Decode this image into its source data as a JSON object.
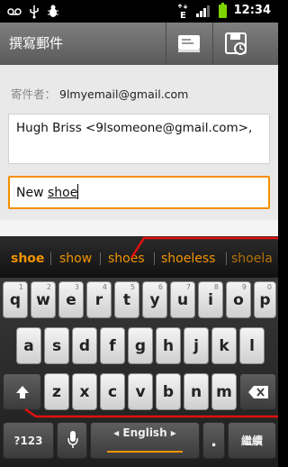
{
  "status_bar": {
    "time": "12:34",
    "icons": [
      "voicemail-icon",
      "usb-icon",
      "debug-icon",
      "edge-data-icon",
      "signal-icon",
      "battery-icon"
    ]
  },
  "title_bar": {
    "title": "撰寫郵件",
    "actions": [
      "send-icon",
      "save-draft-icon"
    ]
  },
  "compose": {
    "from_label": "寄件者：",
    "from_value": "9lmyemail@gmail.com",
    "to_value": "Hugh Briss <9lsomeone@gmail.com>,",
    "subject_prefix": "New ",
    "subject_word": "shoe"
  },
  "suggestions": [
    "shoe",
    "show",
    "shoes",
    "shoeless",
    "shoela"
  ],
  "keyboard": {
    "row1": [
      {
        "label": "q",
        "hint": "1"
      },
      {
        "label": "w",
        "hint": "2"
      },
      {
        "label": "e",
        "hint": "3"
      },
      {
        "label": "r",
        "hint": "4"
      },
      {
        "label": "t",
        "hint": "5"
      },
      {
        "label": "y",
        "hint": "6"
      },
      {
        "label": "u",
        "hint": "7"
      },
      {
        "label": "i",
        "hint": "8"
      },
      {
        "label": "o",
        "hint": "9"
      },
      {
        "label": "p",
        "hint": "0"
      }
    ],
    "row2": [
      "a",
      "s",
      "d",
      "f",
      "g",
      "h",
      "j",
      "k",
      "l"
    ],
    "row3": [
      "z",
      "x",
      "c",
      "v",
      "b",
      "n",
      "m"
    ],
    "symbols_label": "?123",
    "space_label": "◂ English ▸",
    "period_label": ".",
    "enter_label": "繼續"
  },
  "colors": {
    "accent": "#f19400",
    "annotation": "#e01010"
  }
}
